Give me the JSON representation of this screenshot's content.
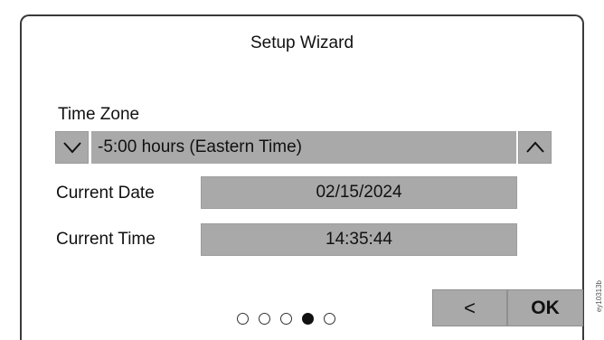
{
  "title": "Setup Wizard",
  "time_zone": {
    "label": "Time Zone",
    "value": "-5:00 hours (Eastern Time)",
    "down_icon": "chevron-down-icon",
    "up_icon": "chevron-up-icon"
  },
  "current_date": {
    "label": "Current Date",
    "value": "02/15/2024"
  },
  "current_time": {
    "label": "Current Time",
    "value": "14:35:44"
  },
  "pagination": {
    "total_steps": 5,
    "active_step": 4
  },
  "buttons": {
    "back_label": "<",
    "ok_label": "OK"
  },
  "image_code": "ey10313b",
  "colors": {
    "field_gray": "#a9a9a9",
    "border": "#3a3a3a"
  }
}
